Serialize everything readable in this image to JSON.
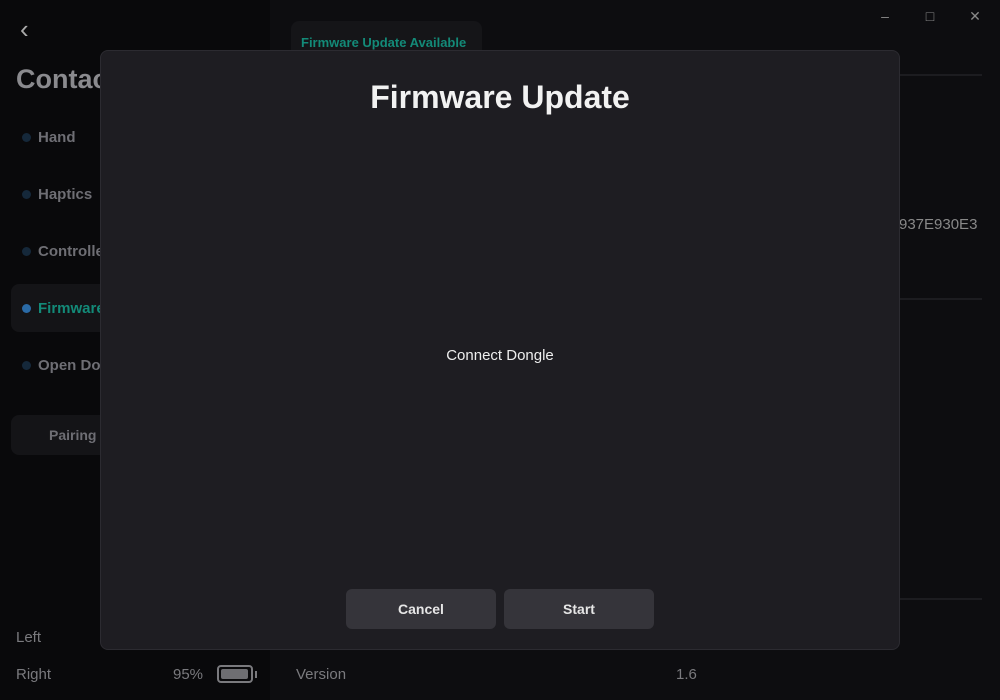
{
  "sidebar": {
    "title": "Contact",
    "items": [
      {
        "label": "Hand",
        "active": false
      },
      {
        "label": "Haptics",
        "active": false
      },
      {
        "label": "Controller",
        "active": false
      },
      {
        "label": "Firmware",
        "active": true
      },
      {
        "label": "Open Dongle",
        "active": false
      }
    ],
    "pairing_label": "Pairing",
    "battery": {
      "left_label": "Left",
      "right_label": "Right",
      "right_percent": "95%",
      "right_level": 95
    }
  },
  "main": {
    "update_badge": "Firmware Update Available",
    "serial_fragment": "937E930E3",
    "version_label": "Version",
    "version_value": "1.6"
  },
  "modal": {
    "title": "Firmware Update",
    "message": "Connect Dongle",
    "cancel_label": "Cancel",
    "start_label": "Start"
  },
  "colors": {
    "accent": "#138a78",
    "active_dot": "#2a6aa6",
    "modal_bg": "#1e1d22"
  }
}
